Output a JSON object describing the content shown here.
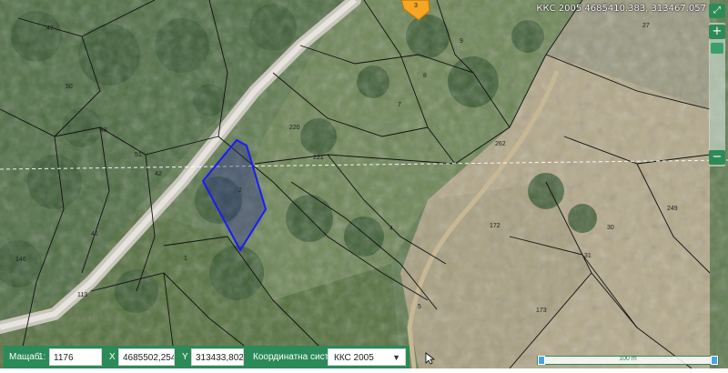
{
  "coordinate_readout": "ККС 2005 4685410.383, 313467.057",
  "parcel_labels": [
    {
      "text": "47"
    },
    {
      "text": "50"
    },
    {
      "text": "48"
    },
    {
      "text": "51"
    },
    {
      "text": "42"
    },
    {
      "text": "46"
    },
    {
      "text": "146"
    },
    {
      "text": "113"
    },
    {
      "text": "1"
    },
    {
      "text": "220"
    },
    {
      "text": "221"
    },
    {
      "text": "9"
    },
    {
      "text": "8"
    },
    {
      "text": "7"
    },
    {
      "text": "262"
    },
    {
      "text": "172"
    },
    {
      "text": "30"
    },
    {
      "text": "31"
    },
    {
      "text": "249"
    },
    {
      "text": "173"
    },
    {
      "text": "27"
    },
    {
      "text": "3"
    },
    {
      "text": "2"
    },
    {
      "text": "4"
    },
    {
      "text": "5"
    }
  ],
  "toolbar": {
    "scale_label": "Мащаб",
    "scale_prefix": "1:",
    "scale_value": "1176",
    "x_label": "X",
    "x_value": "4685502,254",
    "y_label": "Y",
    "y_value": "313433,802",
    "crs_label": "Координатна система",
    "crs_value": "ККС 2005"
  },
  "scalebar": {
    "label": "100 m"
  },
  "controls": {
    "zoom_in": "+",
    "zoom_out": "−"
  },
  "colors": {
    "accent": "#2b8a57",
    "selected_parcel": "#1a1aff",
    "highlight_parcel": "#f5a623"
  }
}
